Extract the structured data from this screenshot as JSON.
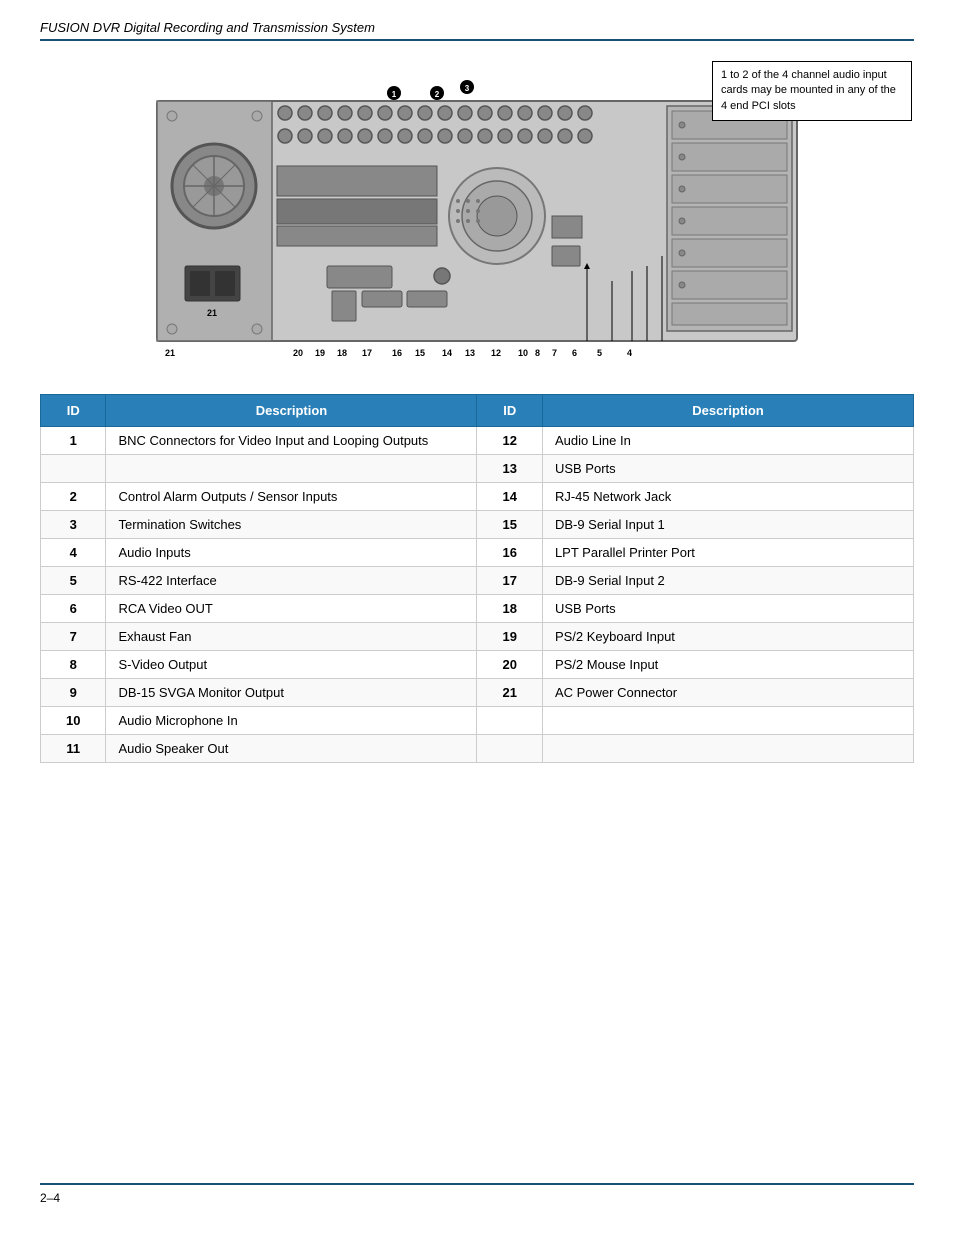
{
  "page": {
    "title": "FUSION DVR Digital Recording and Transmission System",
    "page_number": "2–4"
  },
  "callout": {
    "text": "1 to 2 of the 4 channel audio input cards may be mounted in any of the 4 end PCI slots"
  },
  "table": {
    "col1_header": "ID",
    "col2_header": "Description",
    "col3_header": "ID",
    "col4_header": "Description",
    "rows": [
      {
        "id1": "1",
        "desc1": "BNC Connectors for Video Input and Looping Outputs",
        "id2": "12",
        "desc2": "Audio Line In"
      },
      {
        "id1": "",
        "desc1": "",
        "id2": "13",
        "desc2": "USB Ports"
      },
      {
        "id1": "2",
        "desc1": "Control Alarm Outputs / Sensor Inputs",
        "id2": "14",
        "desc2": "RJ-45 Network Jack"
      },
      {
        "id1": "3",
        "desc1": "Termination Switches",
        "id2": "15",
        "desc2": "DB-9 Serial Input 1"
      },
      {
        "id1": "4",
        "desc1": "Audio Inputs",
        "id2": "16",
        "desc2": "LPT Parallel Printer Port"
      },
      {
        "id1": "5",
        "desc1": "RS-422 Interface",
        "id2": "17",
        "desc2": "DB-9 Serial Input 2"
      },
      {
        "id1": "6",
        "desc1": "RCA Video OUT",
        "id2": "18",
        "desc2": "USB Ports"
      },
      {
        "id1": "7",
        "desc1": "Exhaust Fan",
        "id2": "19",
        "desc2": "PS/2 Keyboard Input"
      },
      {
        "id1": "8",
        "desc1": "S-Video Output",
        "id2": "20",
        "desc2": "PS/2 Mouse Input"
      },
      {
        "id1": "9",
        "desc1": "DB-15 SVGA Monitor Output",
        "id2": "21",
        "desc2": "AC Power Connector"
      },
      {
        "id1": "10",
        "desc1": "Audio Microphone In",
        "id2": "",
        "desc2": ""
      },
      {
        "id1": "11",
        "desc1": "Audio Speaker Out",
        "id2": "",
        "desc2": ""
      }
    ]
  }
}
